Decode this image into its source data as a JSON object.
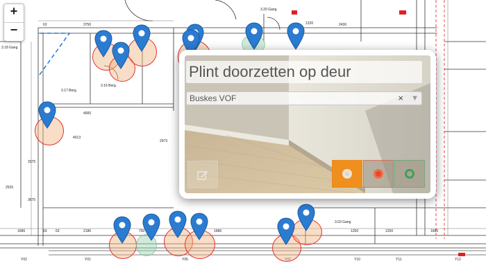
{
  "map": {
    "zoom_in_label": "+",
    "zoom_out_label": "−",
    "dimension_labels": [
      "3750",
      "4000",
      "2973",
      "2436",
      "1686",
      "2186",
      "2525",
      "1686",
      "750",
      "1250",
      "1250",
      "1686",
      "1220",
      "63",
      "63",
      "63",
      "3675",
      "3375",
      "4013"
    ],
    "room_labels": [
      "3.17 Berg.",
      "3.18 Gang",
      "3.20 Gang",
      "3.03 Gang",
      "3.16 Berg.",
      "Y02",
      "Y01",
      "Y05",
      "Y07",
      "Y10",
      "Y11",
      "Y12"
    ]
  },
  "popup": {
    "title": "Plint doorzetten op deur",
    "assignee": "Buskes VOF",
    "clear_symbol": "×",
    "dropdown_symbol": "▼",
    "status_colors": {
      "open": "#ef8f1e",
      "in_progress": "#e54a2a",
      "done": "#3fa05a"
    }
  },
  "icons": {
    "marker": "map-marker-icon",
    "edit": "edit-icon",
    "status_open": "circle-icon",
    "status_in_progress": "circle-icon",
    "status_done": "circle-icon"
  }
}
